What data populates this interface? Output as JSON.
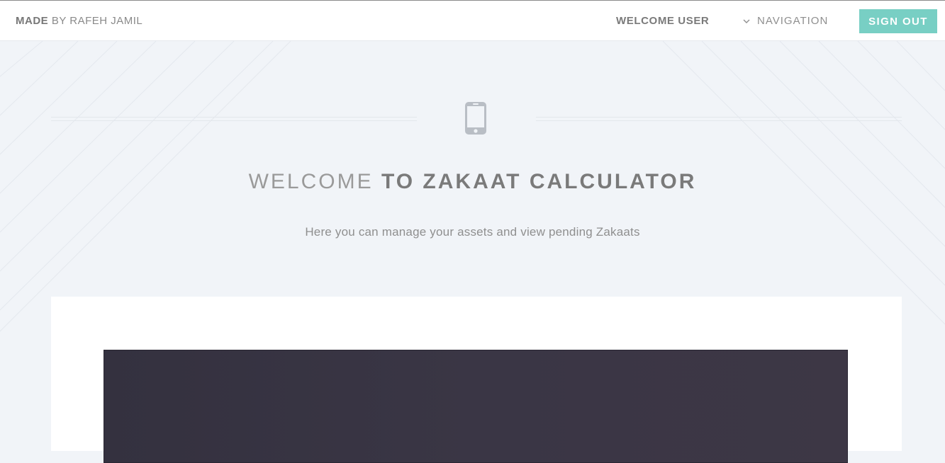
{
  "header": {
    "brand_bold": "MADE",
    "brand_rest": "BY RAFEH JAMIL",
    "welcome_user": "WELCOME USER",
    "nav_label": "NAVIGATION",
    "sign_out_label": "SIGN OUT",
    "nav_icon": "chevron-down-icon"
  },
  "hero": {
    "icon": "mobile-phone-icon",
    "title_thin": "WELCOME",
    "title_bold": "TO ZAKAAT CALCULATOR",
    "subtitle": "Here you can manage your assets and view pending Zakaats"
  },
  "colors": {
    "accent": "#78cfc4",
    "page_bg": "#f1f4f8",
    "panel_dark": "#37333f"
  }
}
